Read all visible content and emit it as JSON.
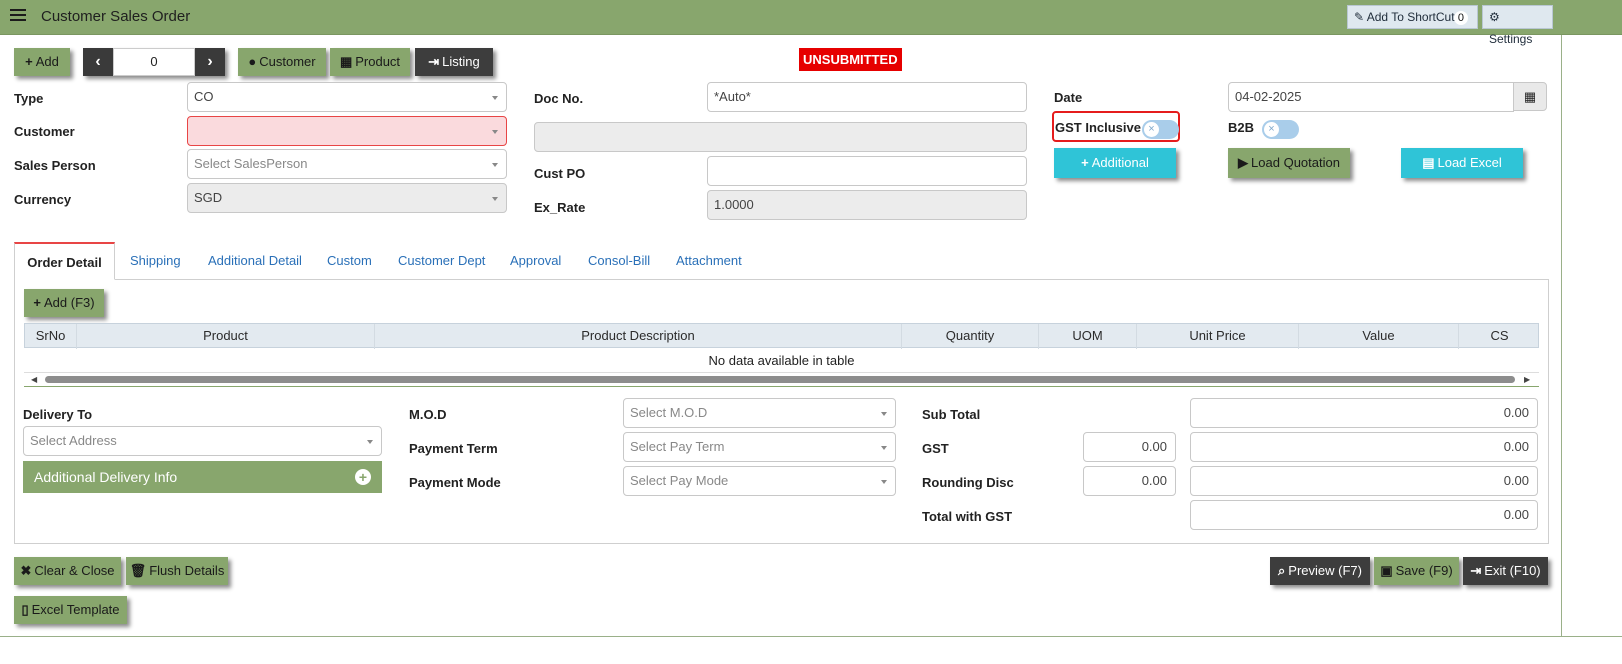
{
  "header": {
    "title": "Customer Sales Order",
    "shortcut_label": "Add To ShortCut",
    "shortcut_count": "0",
    "settings_label": "Settings"
  },
  "toolbar": {
    "add_label": "Add",
    "record_number": "0",
    "customer_label": "Customer",
    "product_label": "Product",
    "listing_label": "Listing",
    "status": "UNSUBMITTED"
  },
  "form": {
    "type_label": "Type",
    "type_value": "CO",
    "customer_label": "Customer",
    "customer_value": "",
    "salesperson_label": "Sales Person",
    "salesperson_placeholder": "Select SalesPerson",
    "currency_label": "Currency",
    "currency_value": "SGD",
    "docno_label": "Doc No.",
    "docno_value": "*Auto*",
    "custpo_label": "Cust PO",
    "exrate_label": "Ex_Rate",
    "exrate_value": "1.0000",
    "date_label": "Date",
    "date_value": "04-02-2025",
    "gst_label": "GST Inclusive",
    "b2b_label": "B2B",
    "additional_label": "Additional",
    "load_quotation_label": "Load Quotation",
    "load_excel_label": "Load Excel"
  },
  "tabs": [
    "Order Detail",
    "Shipping",
    "Additional Detail",
    "Custom",
    "Customer Dept",
    "Approval",
    "Consol-Bill",
    "Attachment"
  ],
  "detail": {
    "add_label": "Add (F3)",
    "columns": [
      "SrNo",
      "Product",
      "Product Description",
      "Quantity",
      "UOM",
      "Unit Price",
      "Value",
      "CS"
    ],
    "empty_text": "No data available in table"
  },
  "delivery": {
    "label": "Delivery To",
    "address_placeholder": "Select Address",
    "additional_info_label": "Additional Delivery Info"
  },
  "payment": {
    "mod_label": "M.O.D",
    "mod_placeholder": "Select M.O.D",
    "term_label": "Payment Term",
    "term_placeholder": "Select Pay Term",
    "mode_label": "Payment Mode",
    "mode_placeholder": "Select Pay Mode"
  },
  "totals": {
    "subtotal_label": "Sub Total",
    "subtotal_value": "0.00",
    "gst_label": "GST",
    "gst_rate": "0.00",
    "gst_value": "0.00",
    "rounding_label": "Rounding Disc",
    "rounding_rate": "0.00",
    "rounding_value": "0.00",
    "total_label": "Total with GST",
    "total_value": "0.00"
  },
  "footer": {
    "clear_label": "Clear & Close",
    "flush_label": "Flush Details",
    "excel_template_label": "Excel Template",
    "preview_label": "Preview (F7)",
    "save_label": "Save (F9)",
    "exit_label": "Exit (F10)"
  },
  "colors": {
    "brand_green": "#88a66d",
    "status_red": "#e60000",
    "accent_cyan": "#2fc4d7",
    "dark_button": "#3d3d3d"
  }
}
